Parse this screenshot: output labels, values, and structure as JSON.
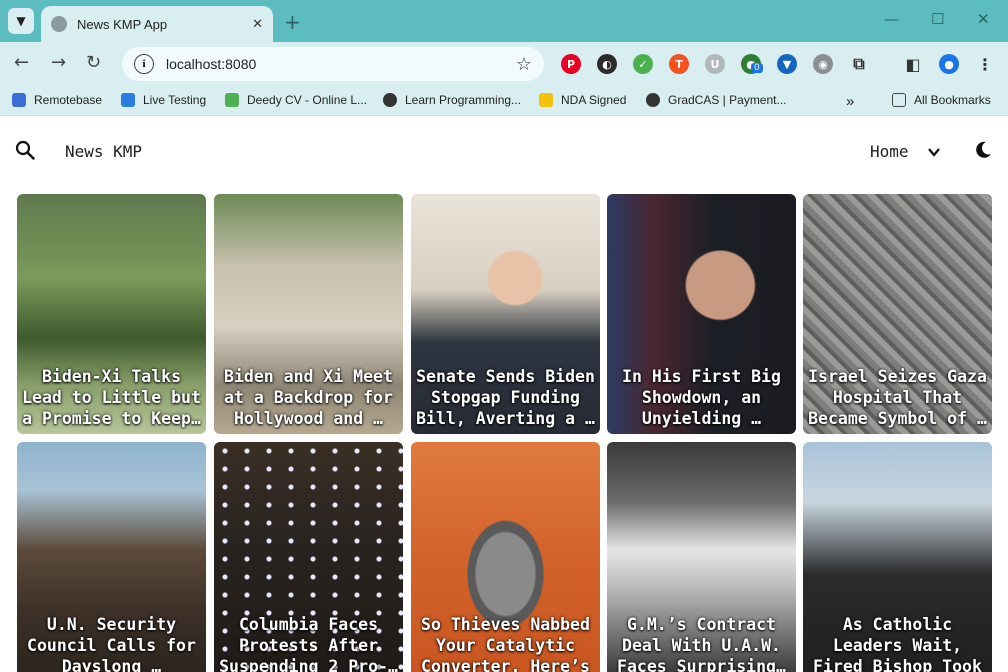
{
  "browser": {
    "tab_title": "News KMP App",
    "url": "localhost:8080",
    "extension_badge": "0",
    "bookmarks": [
      {
        "label": "Remotebase",
        "color": "#3a6fd8"
      },
      {
        "label": "Live Testing",
        "color": "#2a7de1"
      },
      {
        "label": "Deedy CV - Online L...",
        "color": "#4caf50"
      },
      {
        "label": "Learn Programming...",
        "color": "#333333"
      },
      {
        "label": "NDA Signed",
        "color": "#f4c20d"
      },
      {
        "label": "GradCAS | Payment...",
        "color": "#333333"
      }
    ],
    "all_bookmarks": "All Bookmarks",
    "more": "»"
  },
  "app": {
    "title": "News KMP",
    "menu_label": "Home"
  },
  "articles": [
    {
      "title": "Biden-Xi Talks Lead to Little but a Promise to Keep…",
      "img": "garden"
    },
    {
      "title": "Biden and Xi Meet at a Backdrop for Hollywood and …",
      "img": "estate"
    },
    {
      "title": "Senate Sends Biden Stopgap Funding Bill, Averting a …",
      "img": "office"
    },
    {
      "title": "In His First Big Showdown, an Unyielding …",
      "img": "portrait"
    },
    {
      "title": "Israel Seizes Gaza Hospital That Became Symbol of …",
      "img": "aerial"
    },
    {
      "title": "U.N. Security Council Calls for Dayslong …",
      "img": "truck"
    },
    {
      "title": "Columbia Faces Protests After Suspending 2 Pro-…",
      "img": "crowd"
    },
    {
      "title": "So Thieves Nabbed Your Catalytic Converter. Here’s …",
      "img": "metal"
    },
    {
      "title": "G.M.’s Contract Deal With U.A.W. Faces Surprising…",
      "img": "factory"
    },
    {
      "title": "As Catholic Leaders Wait, Fired Bishop Took His …",
      "img": "rally"
    }
  ]
}
